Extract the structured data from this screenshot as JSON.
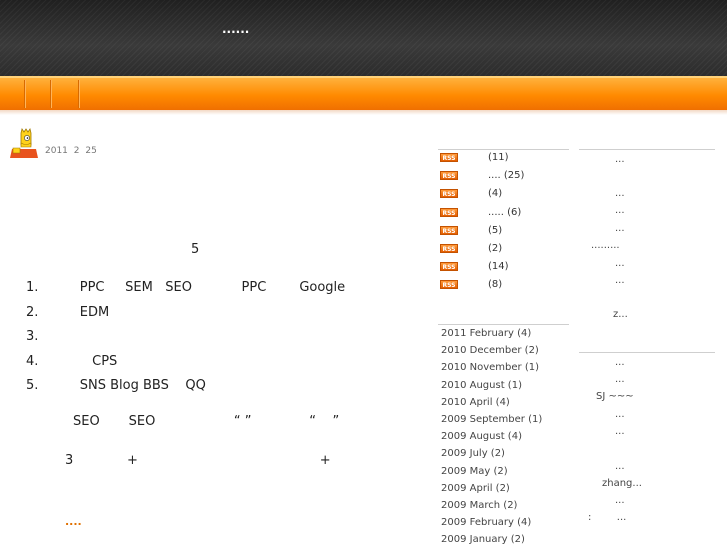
{
  "header": {
    "title": "......"
  },
  "post": {
    "date": "2011  2  25",
    "heading_number": "5",
    "list": [
      {
        "num": "1.",
        "text": "          PPC     SEM   SEO            PPC        Google"
      },
      {
        "num": "2.",
        "text": "          EDM"
      },
      {
        "num": "3.",
        "text": ""
      },
      {
        "num": "4.",
        "text": "             CPS"
      },
      {
        "num": "5.",
        "text": "          SNS Blog BBS    QQ"
      }
    ],
    "line1": "SEO       SEO                   “ ”              “    ”",
    "line2": "3             +                                            +",
    "more": "...."
  },
  "rss_categories": [
    {
      "badge": "RSS",
      "count": "(11)"
    },
    {
      "badge": "RSS",
      "count": ".... (25)"
    },
    {
      "badge": "RSS",
      "count": "(4)"
    },
    {
      "badge": "RSS",
      "count": "..... (6)"
    },
    {
      "badge": "RSS",
      "count": "(5)"
    },
    {
      "badge": "RSS",
      "count": "(2)"
    },
    {
      "badge": "RSS",
      "count": "(14)"
    },
    {
      "badge": "RSS",
      "count": "(8)"
    }
  ],
  "archives": [
    "2011 February (4)",
    "2010 December (2)",
    "2010 November (1)",
    "2010 August (1)",
    "2010 April (4)",
    "2009 September (1)",
    "2009 August (4)",
    "2009 July (2)",
    "2009 May (2)",
    "2009 April (2)",
    "2009 March (2)",
    "2009 February (4)",
    "2009 January (2)"
  ],
  "recent_posts": [
    "...",
    "...",
    "...",
    "...",
    ".........",
    "...",
    "...",
    "z..."
  ],
  "recent_comments": [
    "...",
    "...",
    "SJ ~~~",
    "...",
    "...",
    "...",
    "zhang...",
    "...",
    ":        ..."
  ]
}
